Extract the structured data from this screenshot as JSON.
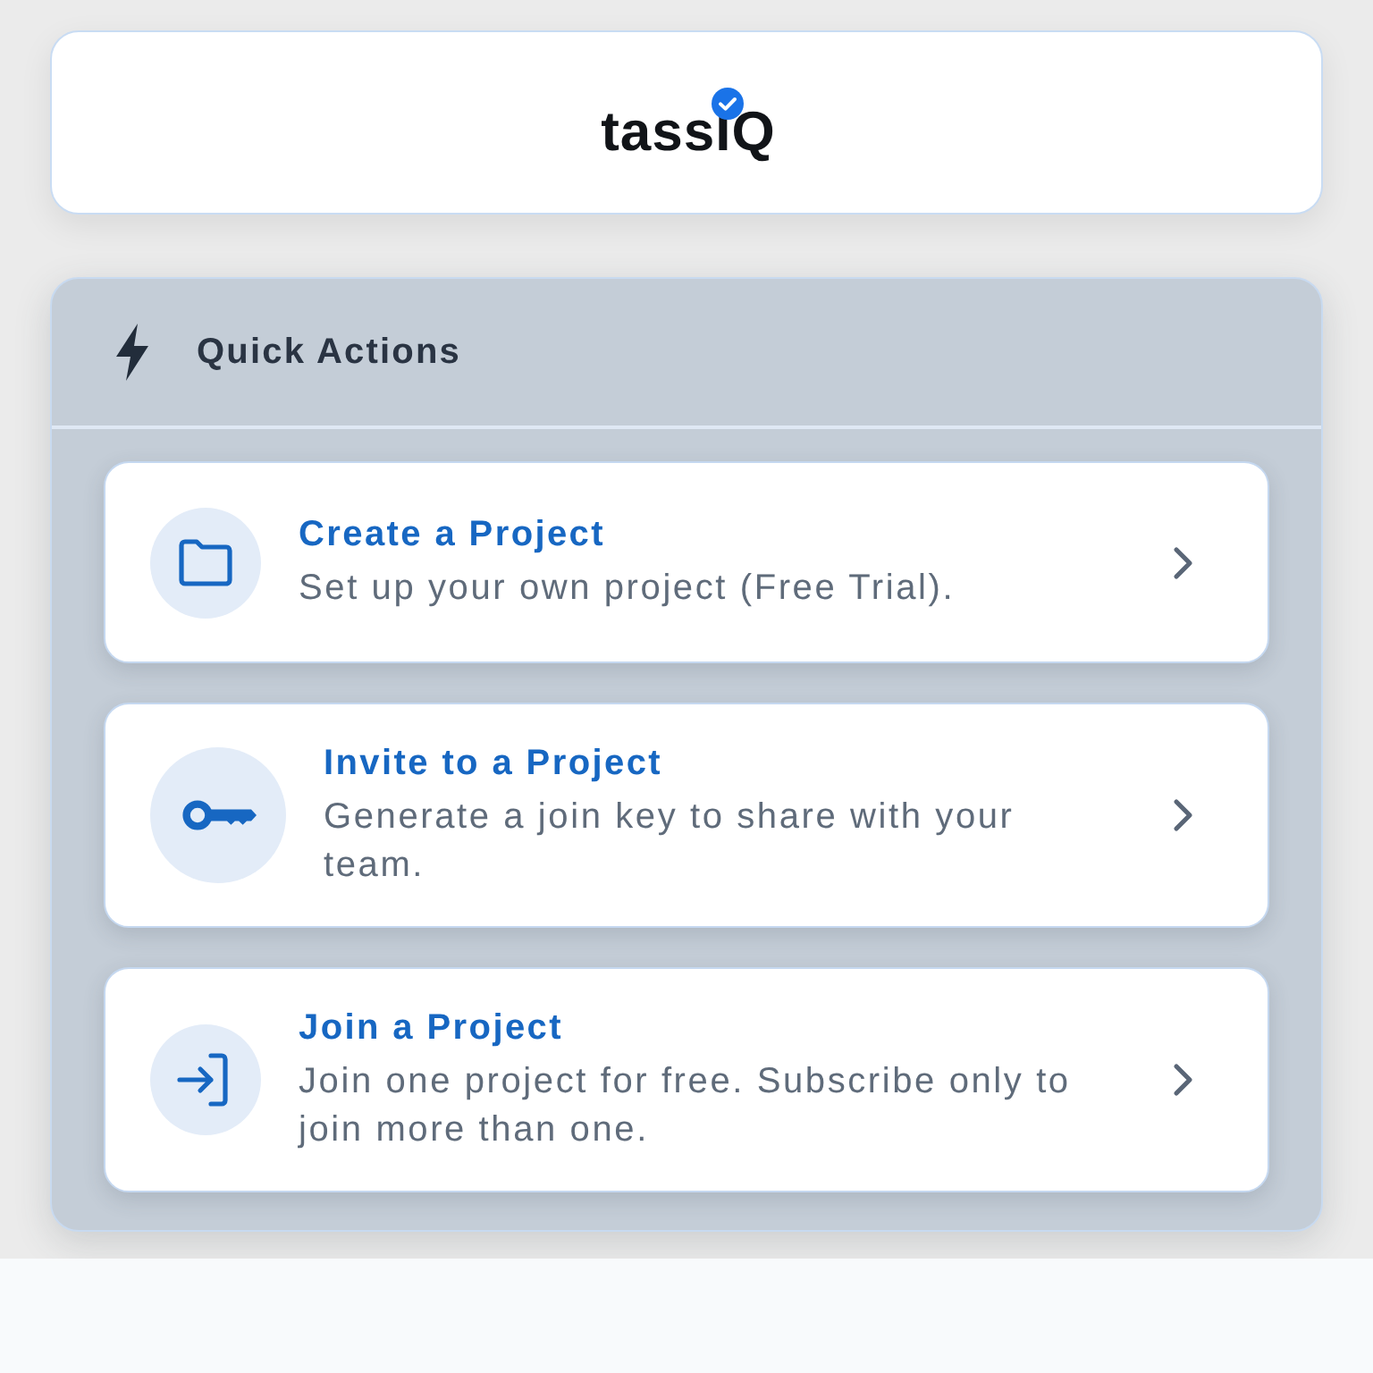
{
  "header": {
    "logo": "tassIQ"
  },
  "quick_actions": {
    "title": "Quick Actions",
    "items": [
      {
        "title": "Create a Project",
        "description": "Set up your own project (Free Trial)."
      },
      {
        "title": "Invite to a Project",
        "description": "Generate a join key to share with your team."
      },
      {
        "title": "Join a Project",
        "description": "Join one project for free. Subscribe only to join more than one."
      }
    ]
  }
}
